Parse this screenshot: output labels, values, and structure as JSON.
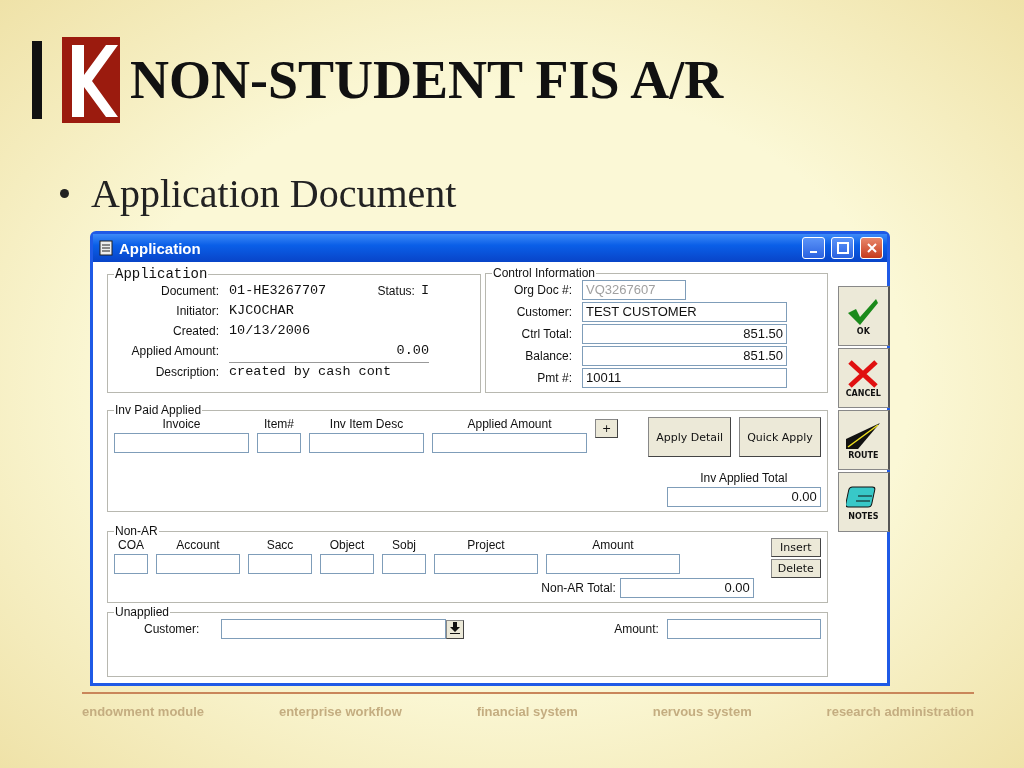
{
  "slide": {
    "title": "NON-STUDENT FIS A/R",
    "bullet": "Application Document"
  },
  "window": {
    "title": "Application"
  },
  "application": {
    "legend": "Application",
    "status_label": "Status:",
    "status_value": "I",
    "fields": [
      {
        "label": "Document:",
        "value": "01-HE3267707",
        "kind": "text"
      },
      {
        "label": "Initiator:",
        "value": "KJCOCHAR",
        "kind": "text"
      },
      {
        "label": "Created:",
        "value": "10/13/2006",
        "kind": "text"
      },
      {
        "label": "Applied Amount:",
        "value": "0.00",
        "kind": "amount"
      },
      {
        "label": "Description:",
        "value": "created by cash cont",
        "kind": "input"
      }
    ]
  },
  "control_information": {
    "legend": "Control Information",
    "fields": [
      {
        "label": "Org Doc #:",
        "value": "VQ3267607",
        "disabled": true,
        "kind": "text"
      },
      {
        "label": "Customer:",
        "value": "TEST CUSTOMER",
        "disabled": false,
        "kind": "text"
      },
      {
        "label": "Ctrl Total:",
        "value": "851.50",
        "disabled": false,
        "kind": "amount"
      },
      {
        "label": "Balance:",
        "value": "851.50",
        "disabled": false,
        "kind": "amount"
      },
      {
        "label": "Pmt #:",
        "value": "10011",
        "disabled": false,
        "kind": "text"
      }
    ]
  },
  "side_buttons": [
    {
      "kind": "ok",
      "label": "OK"
    },
    {
      "kind": "cancel",
      "label": "CANCEL"
    },
    {
      "kind": "route",
      "label": "ROUTE"
    },
    {
      "kind": "notes",
      "label": "NOTES"
    }
  ],
  "inv_paid_applied": {
    "legend": "Inv Paid Applied",
    "columns": [
      "Invoice",
      "Item#",
      "Inv Item Desc",
      "Applied Amount"
    ],
    "plus_button": "+",
    "buttons": [
      "Apply Detail",
      "Quick Apply"
    ],
    "total_label": "Inv Applied Total",
    "total_value": "0.00"
  },
  "non_ar": {
    "legend": "Non-AR",
    "columns": [
      "COA",
      "Account",
      "Sacc",
      "Object",
      "Sobj",
      "Project",
      "Amount"
    ],
    "buttons": [
      "Insert",
      "Delete"
    ],
    "total_label": "Non-AR Total:",
    "total_value": "0.00"
  },
  "unapplied": {
    "legend": "Unapplied",
    "customer_label": "Customer:",
    "amount_label": "Amount:"
  },
  "footer_links": [
    "endowment module",
    "enterprise workflow",
    "financial system",
    "nervous system",
    "research administration"
  ]
}
